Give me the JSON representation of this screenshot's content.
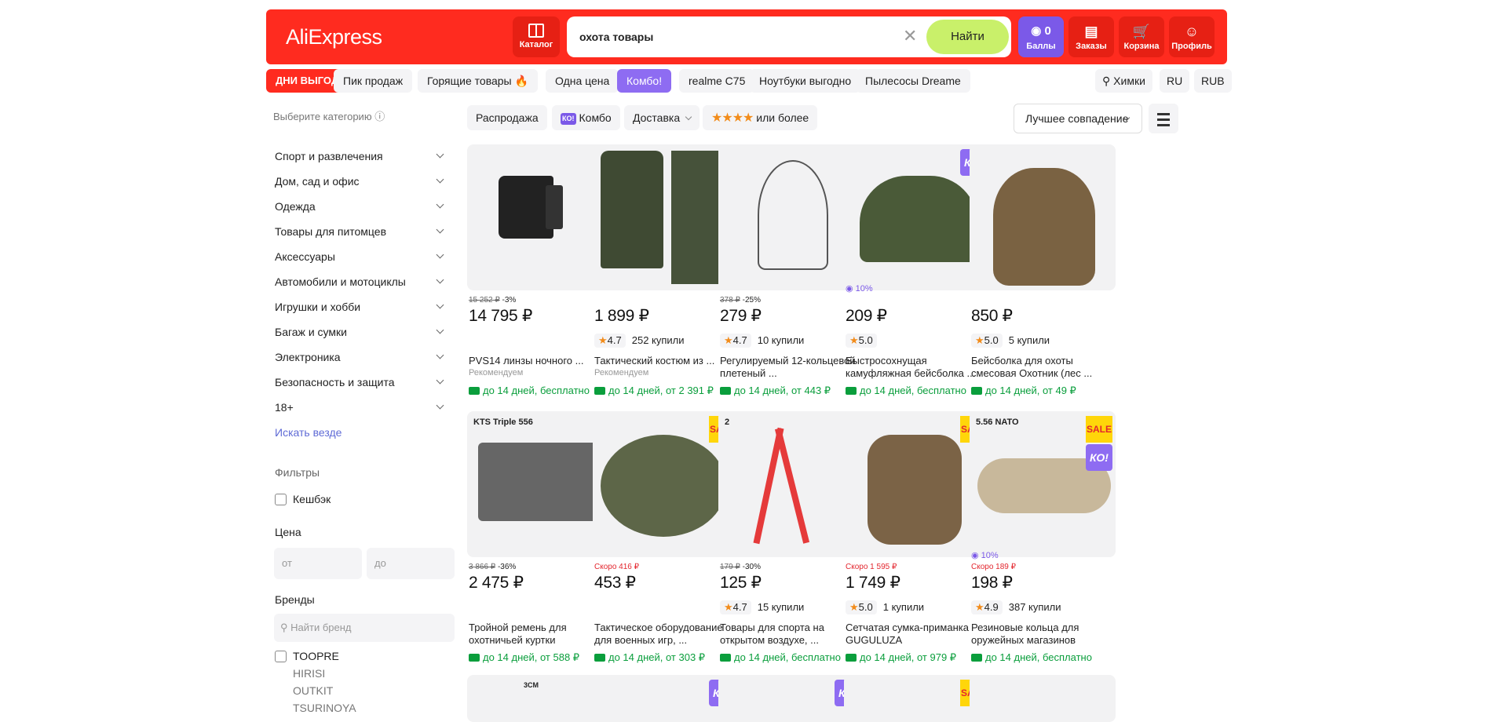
{
  "header": {
    "logo": "AliExpress",
    "catalog": "Каталог",
    "search_value": "охота товары",
    "find": "Найти",
    "bonus_count": "0",
    "bonus": "Баллы",
    "orders": "Заказы",
    "cart": "Корзина",
    "profile": "Профиль"
  },
  "tabs": [
    "ДНИ ВЫГОДЫ",
    "Пик продаж",
    "Горящие товары 🔥",
    "Одна цена",
    "Комбо!",
    "realme C75",
    "Ноутбуки выгодно",
    "Пылесосы Dreame"
  ],
  "locale": {
    "city": "Химки",
    "lang": "RU",
    "currency": "RUB"
  },
  "sidebar": {
    "hint": "Выберите категорию",
    "categories": [
      "Спорт и развлечения",
      "Дом, сад и офис",
      "Одежда",
      "Товары для питомцев",
      "Аксессуары",
      "Автомобили и мотоциклы",
      "Игрушки и хобби",
      "Багаж и сумки",
      "Электроника",
      "Безопасность и защита",
      "18+"
    ],
    "search_all": "Искать везде",
    "filters_title": "Фильтры",
    "cashback": "Кешбэк",
    "price_title": "Цена",
    "price_from": "от",
    "price_to": "до",
    "brands_title": "Бренды",
    "brand_search": "Найти бренд",
    "brands": [
      "TOOPRE",
      "HIRISI",
      "OUTKIT",
      "TSURINOYA"
    ]
  },
  "chips": {
    "sale": "Распродажа",
    "combo_badge": "КО!",
    "combo": "Комбо",
    "delivery": "Доставка",
    "stars": "★★★★",
    "rating": "или более"
  },
  "sort": "Лучшее совпадение",
  "products": [
    {
      "old": "15 252 ₽",
      "disc": "-3%",
      "price": "14 795 ₽",
      "rating": "",
      "sold": "",
      "title": "PVS14 линзы ночного ...",
      "rec": "Рекомендуем",
      "delivery": "до 14 дней, бесплатно"
    },
    {
      "old": "",
      "disc": "",
      "price": "1 899 ₽",
      "rating": "4.7",
      "sold": "252 купили",
      "title": "Тактический костюм из ...",
      "rec": "Рекомендуем",
      "delivery": "до 14 дней, от 2 391 ₽"
    },
    {
      "old": "378 ₽",
      "disc": "-25%",
      "price": "279 ₽",
      "rating": "4.7",
      "sold": "10 купили",
      "title": "Регулируемый 12-кольцевой плетеный ...",
      "rec": "",
      "delivery": "до 14 дней, от 443 ₽"
    },
    {
      "old": "",
      "disc": "",
      "price": "209 ₽",
      "rating": "5.0",
      "sold": "",
      "title": "Быстросохнущая камуфляжная бейсболка ...",
      "rec": "",
      "delivery": "до 14 дней, бесплатно",
      "cashback": "10%",
      "ko": "КО!"
    },
    {
      "old": "",
      "disc": "",
      "price": "850 ₽",
      "rating": "5.0",
      "sold": "5 купили",
      "title": "Бейсболка для охоты смесовая Охотник (лес ...",
      "rec": "",
      "delivery": "до 14 дней, от 49 ₽"
    },
    {
      "old": "3 866 ₽",
      "disc": "-36%",
      "price": "2 475 ₽",
      "rating": "",
      "sold": "",
      "title": "Тройной ремень для охотничьей куртки",
      "rec": "",
      "delivery": "до 14 дней, от 588 ₽",
      "img_text": "KTS Triple 556"
    },
    {
      "soon": "Скоро 416 ₽",
      "price": "453 ₽",
      "rating": "",
      "sold": "",
      "title": "Тактическое оборудование для военных игр, ...",
      "rec": "",
      "delivery": "до 14 дней, от 303 ₽",
      "sale": "SALE"
    },
    {
      "old": "179 ₽",
      "disc": "-30%",
      "price": "125 ₽",
      "rating": "4.7",
      "sold": "15 купили",
      "title": "Товары для спорта на открытом воздухе, ...",
      "rec": "",
      "delivery": "до 14 дней, бесплатно",
      "img_text": "2"
    },
    {
      "soon": "Скоро 1 595 ₽",
      "price": "1 749 ₽",
      "rating": "5.0",
      "sold": "1 купили",
      "title": "Сетчатая сумка-приманка GUGULUZA",
      "rec": "",
      "delivery": "до 14 дней, от 979 ₽",
      "sale": "SALE"
    },
    {
      "soon": "Скоро 189 ₽",
      "price": "198 ₽",
      "rating": "4.9",
      "sold": "387 купили",
      "title": "Резиновые кольца для оружейных магазинов",
      "rec": "",
      "delivery": "до 14 дней, бесплатно",
      "cashback": "10%",
      "sale": "SALE",
      "ko": "КО!",
      "img_text": "5.56 NATO"
    }
  ],
  "row3": [
    {
      "img_text": "3CM"
    },
    {
      "ko": "КО!"
    },
    {
      "ko": "КО!"
    },
    {
      "sale": "SALE"
    },
    {}
  ]
}
